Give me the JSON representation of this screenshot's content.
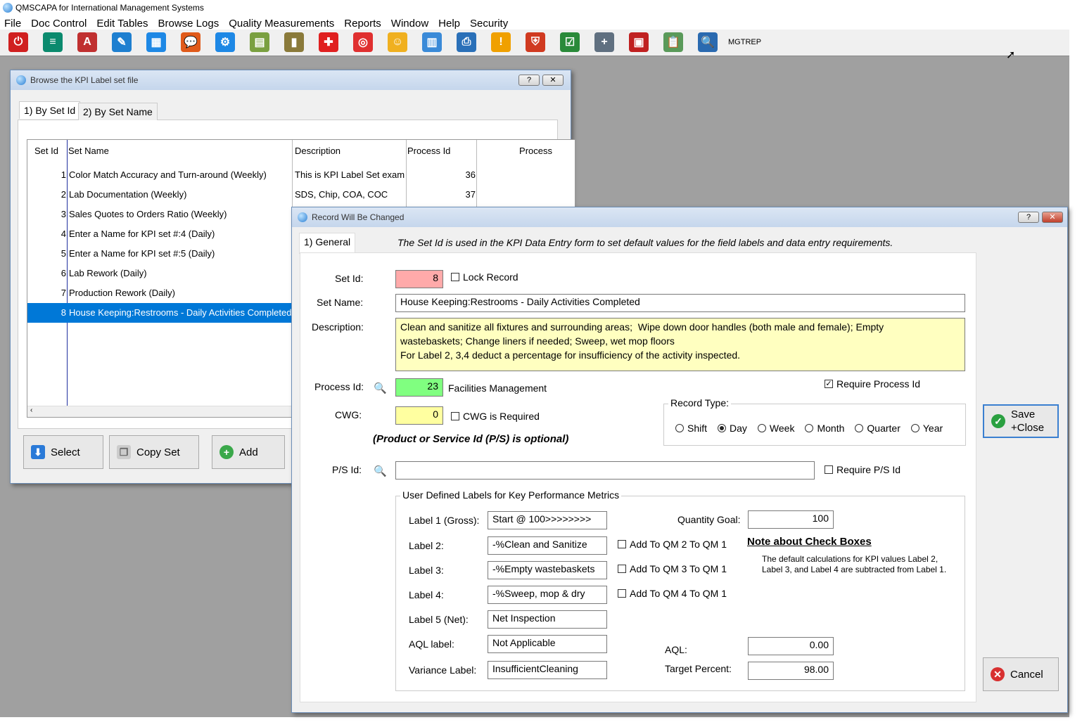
{
  "app": {
    "title": "QMSCAPA for International Management Systems",
    "user": "MGTREP"
  },
  "menu": [
    "File",
    "Doc Control",
    "Edit Tables",
    "Browse Logs",
    "Quality Measurements",
    "Reports",
    "Window",
    "Help",
    "Security"
  ],
  "toolbar_icons": [
    {
      "name": "power-icon",
      "color": "#d02020",
      "glyph": "⏻"
    },
    {
      "name": "document-list-icon",
      "color": "#0b8a6e",
      "glyph": "≡"
    },
    {
      "name": "pdf-icon",
      "color": "#c03030",
      "glyph": "A"
    },
    {
      "name": "notebook-pencil-icon",
      "color": "#1e7fd0",
      "glyph": "✎"
    },
    {
      "name": "org-chart-icon",
      "color": "#1e88e5",
      "glyph": "▦"
    },
    {
      "name": "chat-icon",
      "color": "#e05a1a",
      "glyph": "💬"
    },
    {
      "name": "gear-icon",
      "color": "#1e88e5",
      "glyph": "⚙"
    },
    {
      "name": "calendar-icon",
      "color": "#7aa040",
      "glyph": "▤"
    },
    {
      "name": "address-book-icon",
      "color": "#8a7a3a",
      "glyph": "▮"
    },
    {
      "name": "red-cross-icon",
      "color": "#e02020",
      "glyph": "✚"
    },
    {
      "name": "lifebuoy-icon",
      "color": "#e03030",
      "glyph": "◎"
    },
    {
      "name": "contacts-icon",
      "color": "#f0b020",
      "glyph": "☺"
    },
    {
      "name": "bar-chart-icon",
      "color": "#3a8ad8",
      "glyph": "▥"
    },
    {
      "name": "printer-icon",
      "color": "#2a70b8",
      "glyph": "⎙"
    },
    {
      "name": "warning-icon",
      "color": "#f0a000",
      "glyph": "!"
    },
    {
      "name": "shield-icon",
      "color": "#d03a20",
      "glyph": "⛨"
    },
    {
      "name": "checklist-icon",
      "color": "#2a8a3a",
      "glyph": "☑"
    },
    {
      "name": "database-add-icon",
      "color": "#607080",
      "glyph": "+"
    },
    {
      "name": "id-card-icon",
      "color": "#c02020",
      "glyph": "▣"
    },
    {
      "name": "clipboard-chart-icon",
      "color": "#5a9a5a",
      "glyph": "📋"
    },
    {
      "name": "globe-search-icon",
      "color": "#2a6ab0",
      "glyph": "🔍"
    }
  ],
  "browse": {
    "title": "Browse the KPI Label set file",
    "tabs": [
      "1) By Set Id",
      "2) By Set Name"
    ],
    "columns": [
      "Set Id",
      "Set Name",
      "Description",
      "Process Id",
      "Process"
    ],
    "rows": [
      {
        "id": "1",
        "name": "Color Match Accuracy and Turn-around (Weekly)",
        "desc": "This is KPI Label Set exam",
        "pid": "36"
      },
      {
        "id": "2",
        "name": "Lab Documentation (Weekly)",
        "desc": "SDS, Chip, COA, COC",
        "pid": "37"
      },
      {
        "id": "3",
        "name": "Sales Quotes to Orders Ratio (Weekly)",
        "desc": "",
        "pid": ""
      },
      {
        "id": "4",
        "name": "Enter a Name for KPI set #:4 (Daily)",
        "desc": "",
        "pid": ""
      },
      {
        "id": "5",
        "name": "Enter a Name for KPI set #:5 (Daily)",
        "desc": "",
        "pid": ""
      },
      {
        "id": "6",
        "name": "Lab Rework (Daily)",
        "desc": "",
        "pid": ""
      },
      {
        "id": "7",
        "name": "Production Rework (Daily)",
        "desc": "",
        "pid": ""
      },
      {
        "id": "8",
        "name": "House Keeping:Restrooms - Daily Activities Completed",
        "desc": "",
        "pid": "",
        "selected": true
      }
    ],
    "buttons": {
      "select": "Select",
      "copy": "Copy Set",
      "add": "Add"
    }
  },
  "dialog": {
    "title": "Record Will Be Changed",
    "tab": "1) General",
    "hint": "The Set Id is used in the KPI Data Entry form to set default values for the field labels and data entry requirements.",
    "set_id_label": "Set Id:",
    "set_id": "8",
    "lock_record": "Lock Record",
    "lock_checked": false,
    "set_name_label": "Set Name:",
    "set_name": "House Keeping:Restrooms - Daily Activities Completed",
    "description_label": "Description:",
    "description": "Clean and sanitize all fixtures and surrounding areas;  Wipe down door handles (both male and female); Empty wastebaskets; Change liners if needed; Sweep, wet mop floors\nFor Label 2, 3,4 deduct a percentage for insufficiency of the activity inspected.",
    "process_id_label": "Process Id:",
    "process_id": "23",
    "process_name": "Facilities Management",
    "require_process": "Require Process Id",
    "require_process_checked": true,
    "cwg_label": "CWG:",
    "cwg": "0",
    "cwg_required": "CWG is Required",
    "cwg_checked": false,
    "optional_note": "(Product or Service Id (P/S) is optional)",
    "record_type_label": "Record Type:",
    "record_types": [
      "Shift",
      "Day",
      "Week",
      "Month",
      "Quarter",
      "Year"
    ],
    "record_type_selected": "Day",
    "ps_label": "P/S Id:",
    "ps_value": "",
    "require_ps": "Require P/S Id",
    "require_ps_checked": false,
    "group_label": "User Defined Labels for Key Performance Metrics",
    "labels": [
      {
        "label": "Label 1 (Gross):",
        "value": "Start @ 100>>>>>>>>"
      },
      {
        "label": "Label 2:",
        "value": "-%Clean and Sanitize",
        "qm": "Add To QM 2 To QM 1"
      },
      {
        "label": "Label 3:",
        "value": "-%Empty wastebaskets",
        "qm": "Add To QM 3 To QM 1"
      },
      {
        "label": "Label 4:",
        "value": "-%Sweep, mop & dry",
        "qm": "Add To QM 4 To QM 1"
      },
      {
        "label": "Label 5 (Net):",
        "value": "Net Inspection"
      },
      {
        "label": "AQL label:",
        "value": "Not Applicable"
      },
      {
        "label": "Variance Label:",
        "value": "InsufficientCleaning"
      }
    ],
    "quantity_goal_label": "Quantity Goal:",
    "quantity_goal": "100",
    "note_title": "Note about Check Boxes",
    "note_text": "The default calculations for KPI values Label 2, Label 3, and Label 4 are subtracted from Label 1.",
    "aql_label": "AQL:",
    "aql": "0.00",
    "target_label": "Target Percent:",
    "target": "98.00",
    "save": "Save\n+Close",
    "cancel": "Cancel"
  },
  "colors": {
    "selection": "#0078d7",
    "set_id_bg": "#ffaaaa",
    "process_bg": "#80ff80",
    "cwg_bg": "#ffffa0",
    "desc_bg": "#ffffc0"
  }
}
